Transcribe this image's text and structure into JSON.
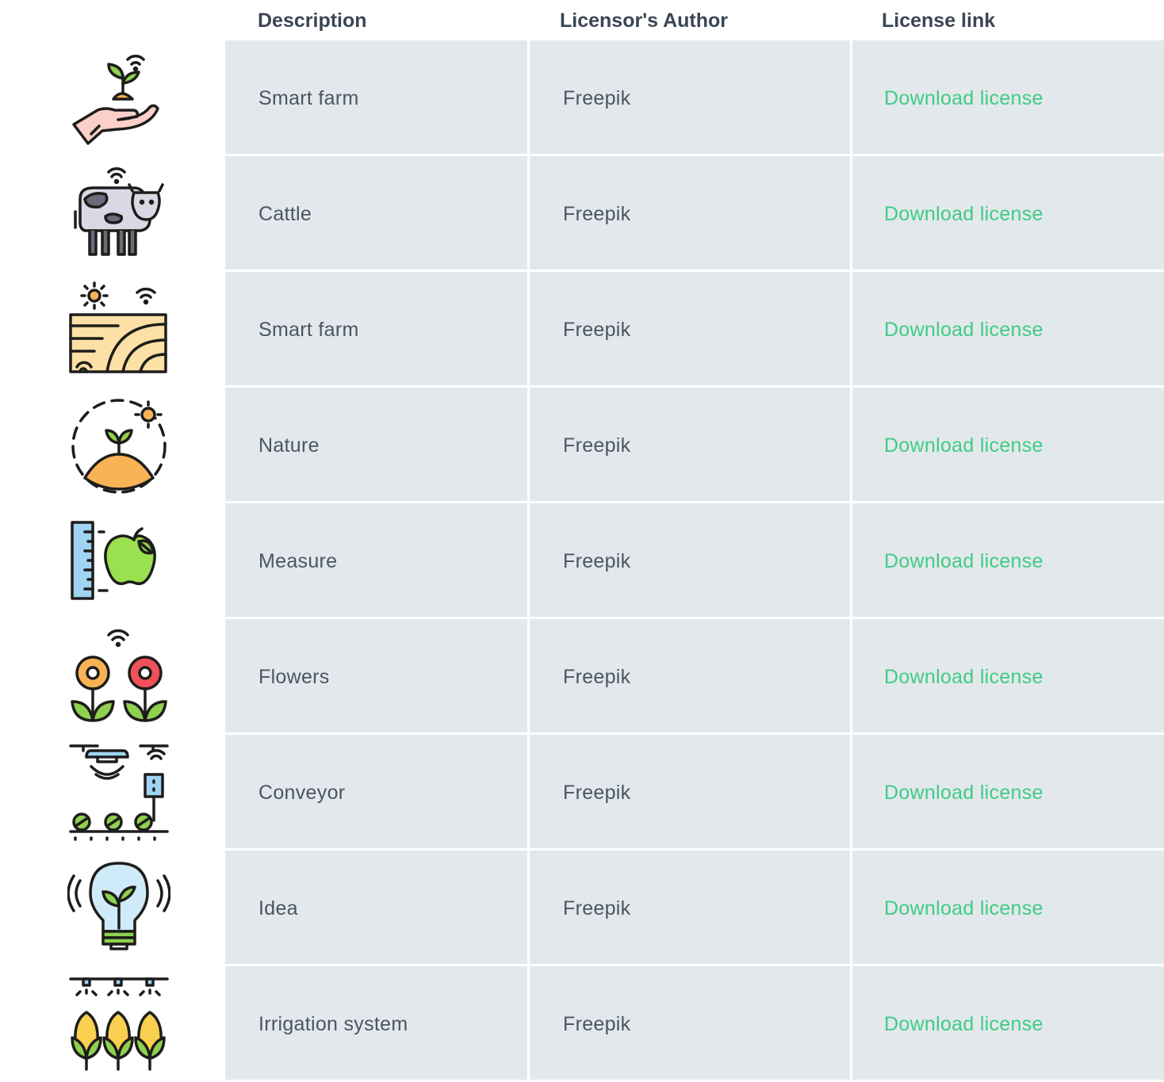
{
  "header": {
    "description": "Description",
    "author": "Licensor's Author",
    "link": "License link"
  },
  "rows": [
    {
      "icon": "smart-farm-hand-icon",
      "description": "Smart farm",
      "author": "Freepik",
      "link": "Download license"
    },
    {
      "icon": "cattle-icon",
      "description": "Cattle",
      "author": "Freepik",
      "link": "Download license"
    },
    {
      "icon": "smart-farm-field-icon",
      "description": "Smart farm",
      "author": "Freepik",
      "link": "Download license"
    },
    {
      "icon": "nature-icon",
      "description": "Nature",
      "author": "Freepik",
      "link": "Download license"
    },
    {
      "icon": "measure-icon",
      "description": "Measure",
      "author": "Freepik",
      "link": "Download license"
    },
    {
      "icon": "flowers-icon",
      "description": "Flowers",
      "author": "Freepik",
      "link": "Download license"
    },
    {
      "icon": "conveyor-icon",
      "description": "Conveyor",
      "author": "Freepik",
      "link": "Download license"
    },
    {
      "icon": "idea-icon",
      "description": "Idea",
      "author": "Freepik",
      "link": "Download license"
    },
    {
      "icon": "irrigation-system-icon",
      "description": "Irrigation system",
      "author": "Freepik",
      "link": "Download license"
    }
  ],
  "colors": {
    "header_text": "#3b4554",
    "cell_background": "#e3e8ec",
    "body_text": "#4a5564",
    "link": "#3fcc85"
  }
}
